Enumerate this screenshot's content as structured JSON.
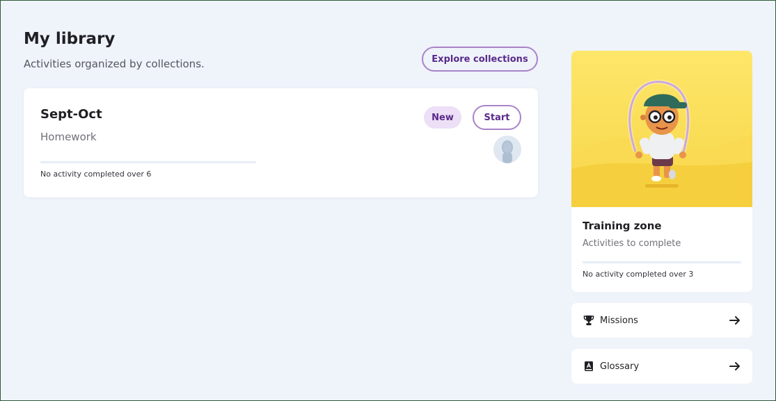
{
  "header": {
    "title": "My library",
    "subtitle": "Activities organized by collections.",
    "explore_label": "Explore collections"
  },
  "collection": {
    "title": "Sept-Oct",
    "category": "Homework",
    "badge": "New",
    "start_label": "Start",
    "status": "No activity completed over 6",
    "progress": 0
  },
  "training": {
    "title": "Training zone",
    "subtitle": "Activities to complete",
    "status": "No activity completed over 3",
    "progress": 0
  },
  "links": [
    {
      "label": "Missions",
      "icon": "trophy-icon"
    },
    {
      "label": "Glossary",
      "icon": "book-icon"
    }
  ],
  "colors": {
    "accent": "#5a2a8a",
    "accent_border": "#a982c9",
    "badge_bg": "#ecdff6",
    "background": "#eff3fa",
    "illustration_yellow": "#fde35c"
  }
}
